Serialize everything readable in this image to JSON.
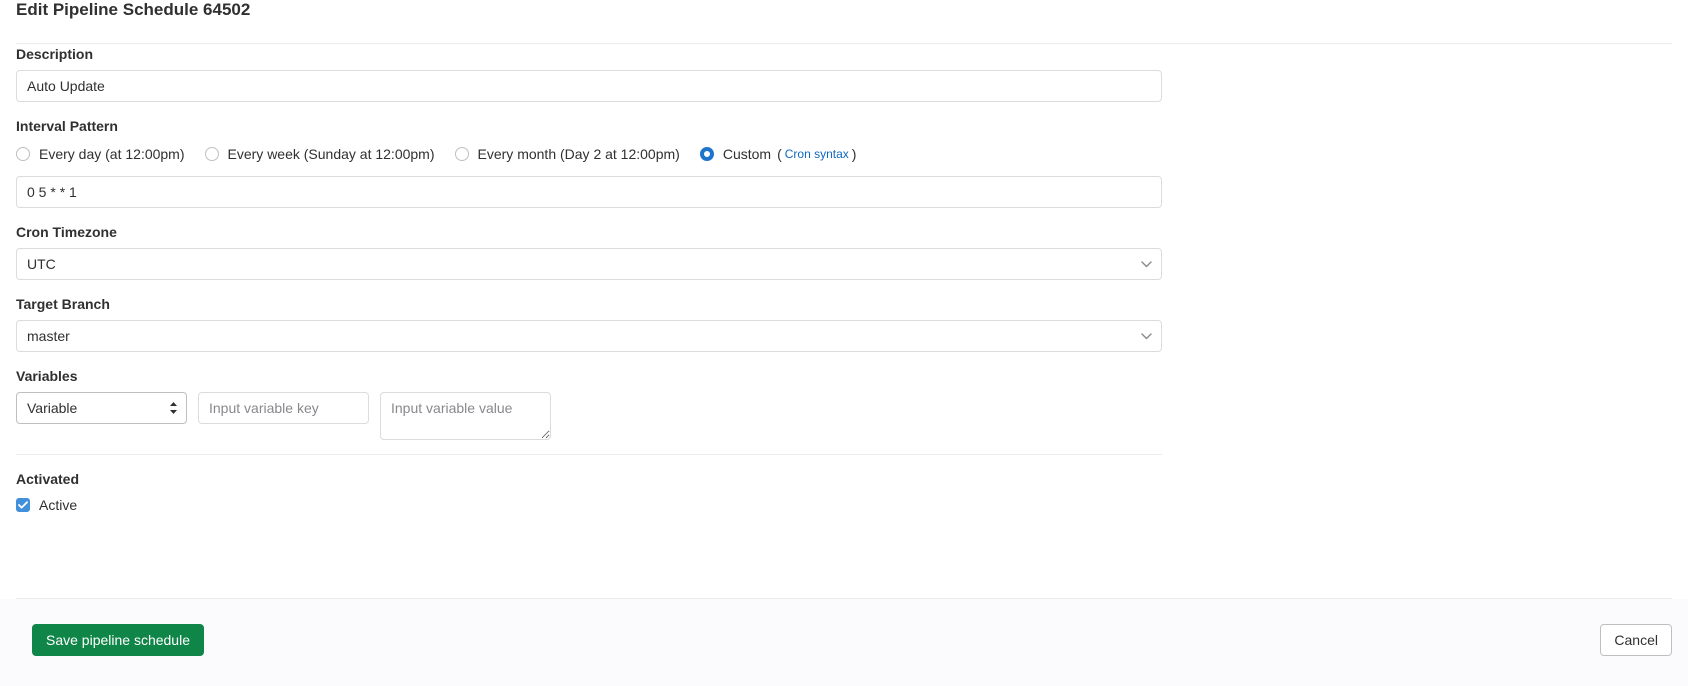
{
  "header": {
    "title": "Edit Pipeline Schedule 64502"
  },
  "description": {
    "label": "Description",
    "value": "Auto Update",
    "placeholder": ""
  },
  "interval": {
    "label": "Interval Pattern",
    "options": [
      {
        "label": "Every day (at 12:00pm)",
        "selected": false
      },
      {
        "label": "Every week (Sunday at 12:00pm)",
        "selected": false
      },
      {
        "label": "Every month (Day 2 at 12:00pm)",
        "selected": false
      },
      {
        "label": "Custom",
        "selected": true
      }
    ],
    "custom_label": "Custom",
    "paren_open": "(",
    "cron_link": "Cron syntax",
    "paren_close": ")",
    "cron_value": "0 5 * * 1",
    "cron_placeholder": ""
  },
  "timezone": {
    "label": "Cron Timezone",
    "value": "UTC"
  },
  "branch": {
    "label": "Target Branch",
    "value": "master"
  },
  "variables": {
    "label": "Variables",
    "type_value": "Variable",
    "key_placeholder": "Input variable key",
    "key_value": "",
    "value_placeholder": "Input variable value",
    "value_value": ""
  },
  "activated": {
    "label": "Activated",
    "checkbox_label": "Active",
    "checked": true
  },
  "footer": {
    "save_label": "Save pipeline schedule",
    "cancel_label": "Cancel"
  },
  "colors": {
    "accent_blue": "#1f75cb",
    "link_blue": "#1068bf",
    "save_green": "#108548",
    "checkbox_blue": "#428fdc",
    "text": "#303030",
    "border": "#dcdcde",
    "footer_bg": "#fbfafd"
  }
}
